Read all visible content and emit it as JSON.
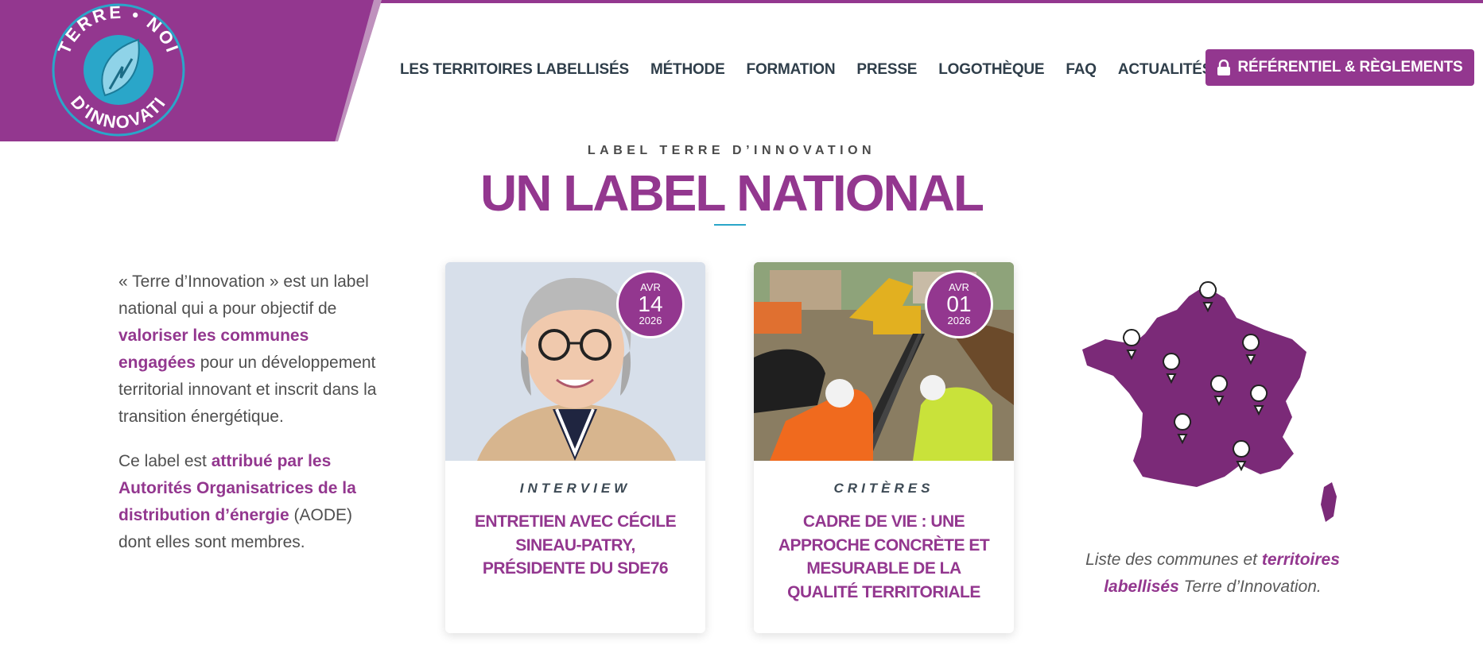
{
  "brand": {
    "logo_text": "TERRE D'INNOVATION",
    "accent": "#93378f",
    "secondary": "#2aa6c9"
  },
  "nav": {
    "items": [
      {
        "label": "LES TERRITOIRES LABELLISÉS"
      },
      {
        "label": "MÉTHODE"
      },
      {
        "label": "FORMATION"
      },
      {
        "label": "PRESSE"
      },
      {
        "label": "LOGOTHÈQUE"
      },
      {
        "label": "FAQ"
      },
      {
        "label": "ACTUALITÉS"
      }
    ],
    "cta_label": "RÉFÉRENTIEL & RÈGLEMENTS",
    "cta_icon": "lock-icon"
  },
  "hero": {
    "eyebrow": "LABEL TERRE D’INNOVATION",
    "title": "UN LABEL NATIONAL"
  },
  "intro": {
    "p1_a": "« Terre d’Innovation » est un label national qui a pour objectif de ",
    "p1_strong": "valoriser les communes engagées",
    "p1_b": " pour un développement territorial innovant et inscrit dans la transition énergétique.",
    "p2_a": "Ce label est ",
    "p2_strong": "attribué par les Autorités Organisatrices de la distribution d’énergie",
    "p2_b": " (AODE) dont elles sont membres."
  },
  "cards": [
    {
      "month": "AVR",
      "day": "14",
      "year": "2026",
      "category": "INTERVIEW",
      "title": "ENTRETIEN AVEC CÉCILE SINEAU-PATRY, PRÉSIDENTE DU SDE76"
    },
    {
      "month": "AVR",
      "day": "01",
      "year": "2026",
      "category": "CRITÈRES",
      "title": "CADRE DE VIE : UNE APPROCHE CONCRÈTE ET MESURABLE DE LA QUALITÉ TERRITORIALE"
    }
  ],
  "map": {
    "caption_a": "Liste des communes et ",
    "caption_strong": "territoires labellisés",
    "caption_b": " Terre d’Innovation."
  }
}
